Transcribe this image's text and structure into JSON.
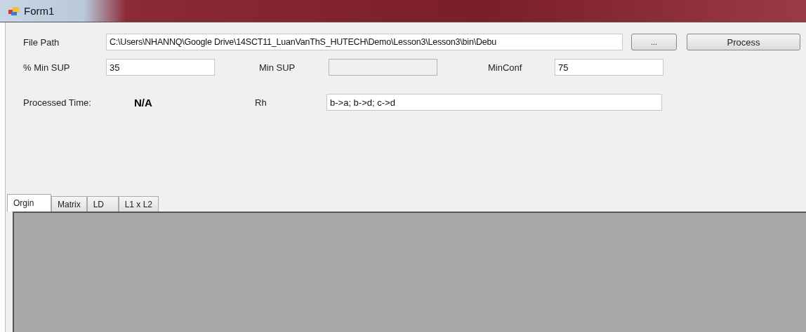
{
  "window": {
    "title": "Form1"
  },
  "file_path": {
    "label": "File Path",
    "value": "C:\\Users\\NHANNQ\\Google Drive\\14SCT11_LuanVanThS_HUTECH\\Demo\\Lesson3\\Lesson3\\bin\\Debu"
  },
  "buttons": [
    {
      "label": "..."
    },
    {
      "label": "Process"
    }
  ],
  "min_sup_percent": {
    "label": "% Min SUP",
    "value": "35"
  },
  "min_sup": {
    "label": "Min SUP",
    "disabled": true
  },
  "min_conf": {
    "label": "MinConf",
    "value": "75"
  },
  "processed_time": {
    "label": "Processed Time:",
    "value": "N/A"
  },
  "rh": {
    "label": "Rh",
    "value": "b->a; b->d; c->d"
  },
  "tabs": [
    {
      "label": "Orgin",
      "selected": true
    },
    {
      "label": "Matrix",
      "selected": false
    },
    {
      "label": "LD",
      "selected": false
    },
    {
      "label": "L1 x L2",
      "selected": false
    }
  ]
}
